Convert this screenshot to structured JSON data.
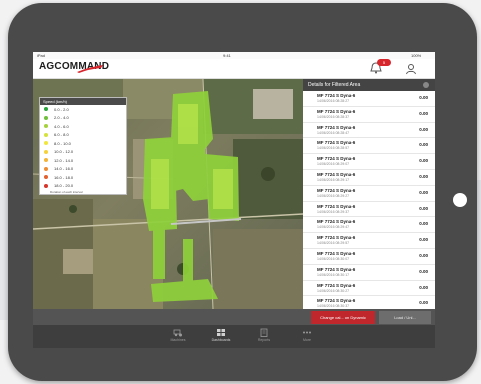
{
  "status_bar": {
    "carrier": "iPad",
    "time": "9:41",
    "battery": "100%"
  },
  "header": {
    "logo_text": "AGCOMMAND",
    "notification_count": "5"
  },
  "legend": {
    "title": "Speed (km/h)",
    "entries": [
      {
        "label": "0.0 - 2.0",
        "color": "#2aa53a"
      },
      {
        "label": "2.0 - 4.0",
        "color": "#6fbf3a"
      },
      {
        "label": "4.0 - 6.0",
        "color": "#a6d13c"
      },
      {
        "label": "6.0 - 8.0",
        "color": "#d5e23b"
      },
      {
        "label": "8.0 - 10.0",
        "color": "#f0e63c"
      },
      {
        "label": "10.0 - 12.0",
        "color": "#f5d23a"
      },
      {
        "label": "12.0 - 14.0",
        "color": "#f3b437"
      },
      {
        "label": "14.0 - 16.0",
        "color": "#ee8c33"
      },
      {
        "label": "16.0 - 18.0",
        "color": "#e4602e"
      },
      {
        "label": "18.0 - 20.0",
        "color": "#d8352a"
      }
    ],
    "footer": "Duration of each interval"
  },
  "panel": {
    "title": "Details for Filtered Area",
    "rows": [
      {
        "title": "MF 7724 S Dyna-6",
        "sub": "14/06/2016 08:28:27",
        "value": "0.00"
      },
      {
        "title": "MF 7724 S Dyna-6",
        "sub": "14/06/2016 08:28:37",
        "value": "0.00"
      },
      {
        "title": "MF 7724 S Dyna-6",
        "sub": "14/06/2016 08:28:47",
        "value": "0.00"
      },
      {
        "title": "MF 7724 S Dyna-6",
        "sub": "14/06/2016 08:28:57",
        "value": "0.00"
      },
      {
        "title": "MF 7724 S Dyna-6",
        "sub": "14/06/2016 08:29:07",
        "value": "0.00"
      },
      {
        "title": "MF 7724 S Dyna-6",
        "sub": "14/06/2016 08:29:17",
        "value": "0.00"
      },
      {
        "title": "MF 7724 S Dyna-6",
        "sub": "14/06/2016 08:29:27",
        "value": "0.00"
      },
      {
        "title": "MF 7724 S Dyna-6",
        "sub": "14/06/2016 08:29:37",
        "value": "0.00"
      },
      {
        "title": "MF 7724 S Dyna-6",
        "sub": "14/06/2016 08:29:47",
        "value": "0.00"
      },
      {
        "title": "MF 7724 S Dyna-6",
        "sub": "14/06/2016 08:29:57",
        "value": "0.00"
      },
      {
        "title": "MF 7724 S Dyna-6",
        "sub": "14/06/2016 08:30:07",
        "value": "0.00"
      },
      {
        "title": "MF 7724 S Dyna-6",
        "sub": "14/06/2016 08:30:17",
        "value": "0.00"
      },
      {
        "title": "MF 7724 S Dyna-6",
        "sub": "14/06/2016 08:30:27",
        "value": "0.00"
      },
      {
        "title": "MF 7724 S Dyna-6",
        "sub": "14/06/2016 08:30:37",
        "value": "0.00"
      },
      {
        "title": "MF 7724 S Dyna-6",
        "sub": "14/06/2016 08:30:47",
        "value": "0.00"
      }
    ]
  },
  "actions": {
    "primary_label": "Change cal... on Dynamic",
    "secondary_label": "Load / Unl..."
  },
  "tabs": [
    {
      "label": "Machines"
    },
    {
      "label": "Dashboards"
    },
    {
      "label": "Reports"
    },
    {
      "label": "More"
    }
  ]
}
